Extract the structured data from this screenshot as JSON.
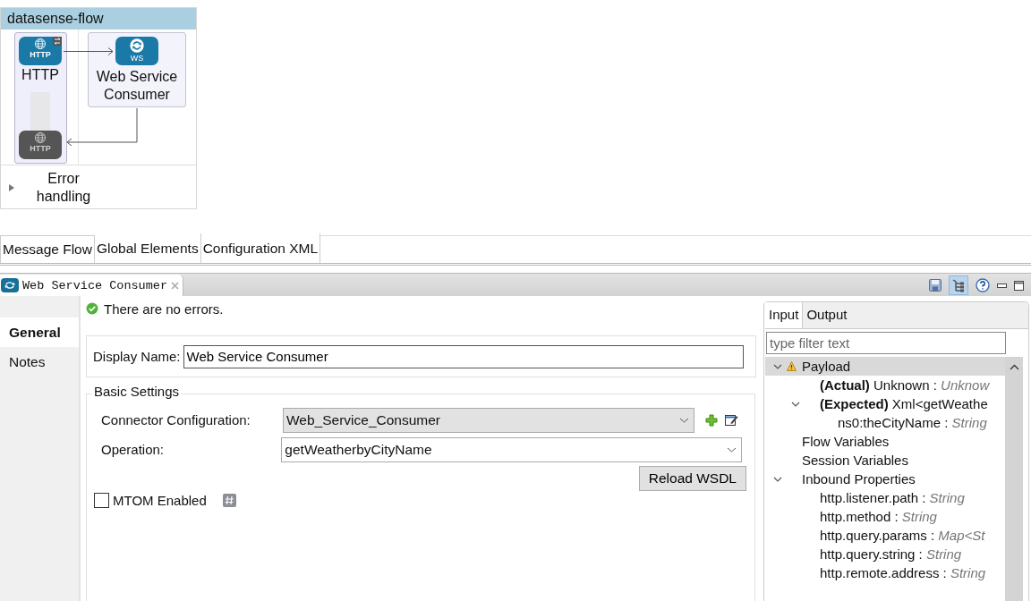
{
  "flow": {
    "title": "datasense-flow",
    "source": {
      "label": "HTTP",
      "badge": "HTTP"
    },
    "processor": {
      "label": "Web Service Consumer",
      "badge": "WS"
    },
    "response": {
      "badge": "HTTP"
    },
    "error_handling": {
      "label": "Error handling",
      "expanded": false
    }
  },
  "editor_tabs": [
    {
      "label": "Message Flow",
      "selected": true
    },
    {
      "label": "Global Elements",
      "selected": false
    },
    {
      "label": "Configuration XML",
      "selected": false
    }
  ],
  "view": {
    "title": "Web Service Consumer"
  },
  "side_tabs": [
    {
      "label": "General",
      "selected": true
    },
    {
      "label": "Notes",
      "selected": false
    }
  ],
  "status": "There are no errors.",
  "display_name": {
    "label": "Display Name:",
    "value": "Web Service Consumer"
  },
  "basic_settings": {
    "title": "Basic Settings",
    "connector": {
      "label": "Connector Configuration:",
      "value": "Web_Service_Consumer"
    },
    "operation": {
      "label": "Operation:",
      "value": "getWeatherbyCityName"
    },
    "reload_button": "Reload WSDL",
    "mtom": {
      "label": "MTOM Enabled",
      "checked": false
    }
  },
  "metadata": {
    "tabs": [
      {
        "label": "Input",
        "selected": true
      },
      {
        "label": "Output",
        "selected": false
      }
    ],
    "filter": {
      "placeholder": "type filter text"
    },
    "tree": [
      {
        "label": "Payload",
        "warning": true,
        "selected": true,
        "expanded": true,
        "children": [
          {
            "label": "**(Actual)** Unknown :",
            "type": "Unknow",
            "selected": false
          },
          {
            "label": "**(Expected)** Xml<getWeathe",
            "selected": false,
            "expanded": true,
            "children": [
              {
                "label": "ns0:theCityName :",
                "type": "String",
                "selected": false
              }
            ]
          }
        ]
      },
      {
        "label": "Flow Variables",
        "selected": false
      },
      {
        "label": "Session Variables",
        "selected": false
      },
      {
        "label": "Inbound Properties",
        "selected": false,
        "expanded": true,
        "children": [
          {
            "label": "http.listener.path :",
            "type": "String",
            "selected": false
          },
          {
            "label": "http.method :",
            "type": "String",
            "selected": false
          },
          {
            "label": "http.query.params :",
            "type": "Map<St",
            "selected": false
          },
          {
            "label": "http.query.string :",
            "type": "String",
            "selected": false
          },
          {
            "label": "http.remote.address :",
            "type": "String",
            "selected": false
          }
        ]
      }
    ]
  }
}
